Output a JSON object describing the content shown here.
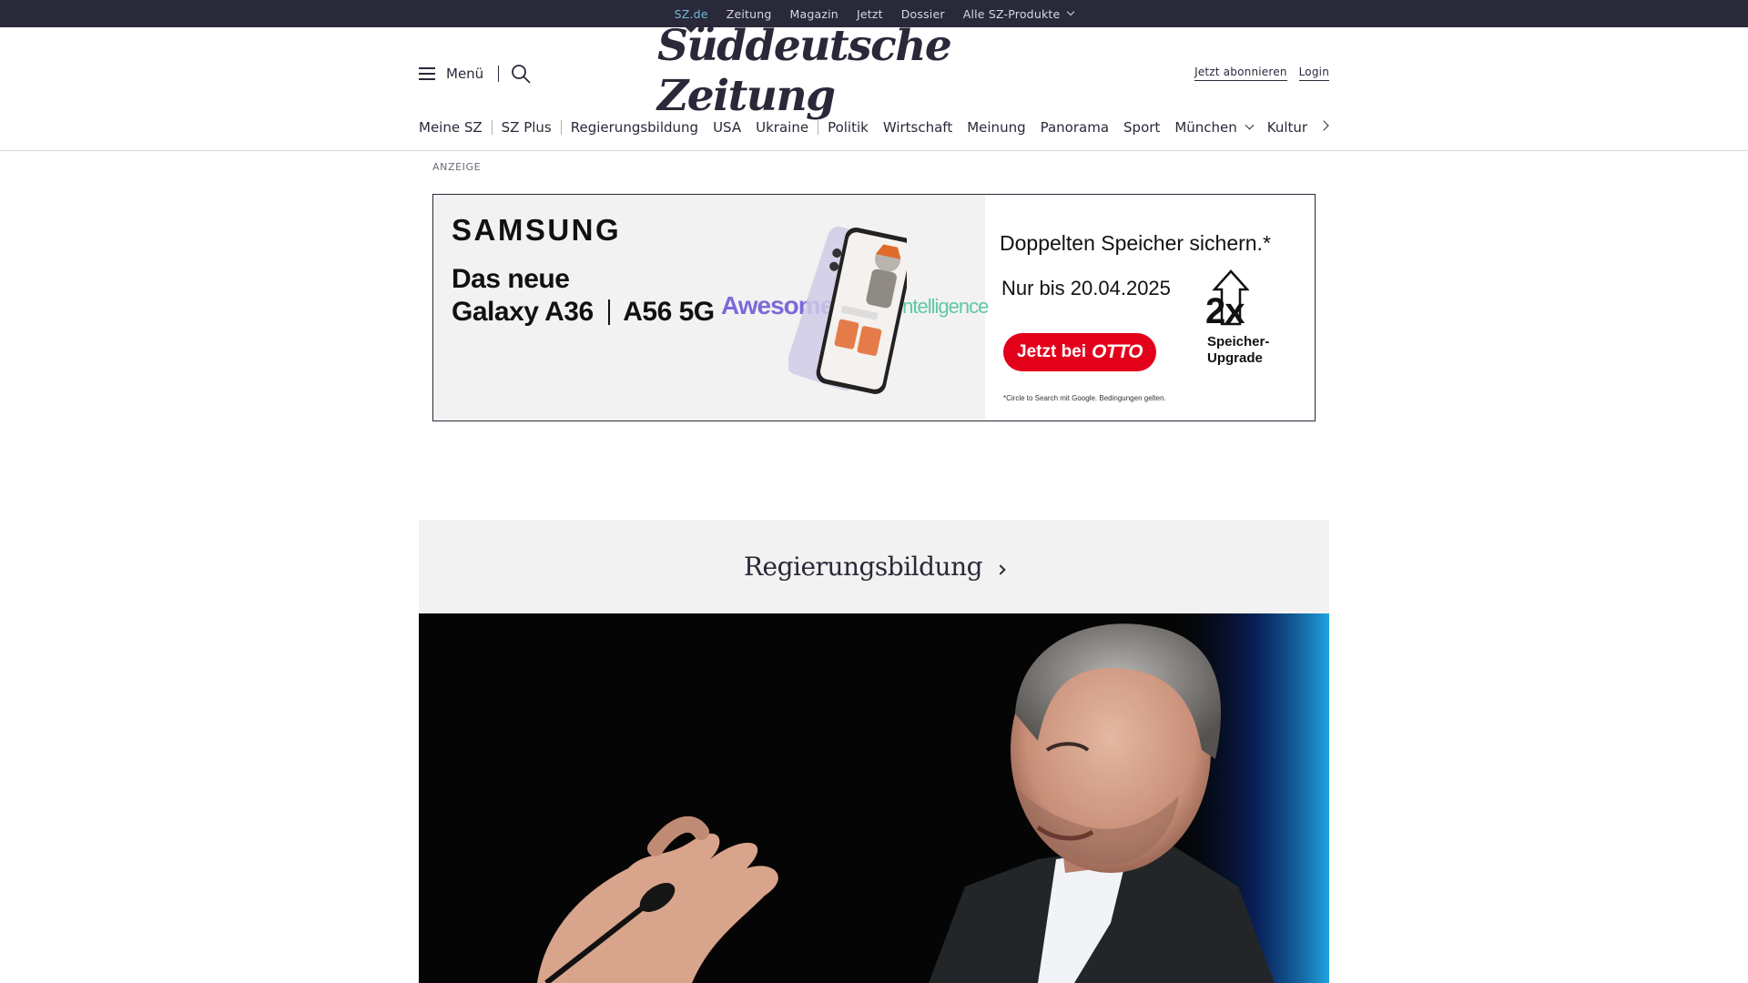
{
  "topbar": {
    "links": [
      {
        "label": "SZ.de",
        "active": true
      },
      {
        "label": "Zeitung"
      },
      {
        "label": "Magazin"
      },
      {
        "label": "Jetzt"
      },
      {
        "label": "Dossier"
      },
      {
        "label": "Alle SZ-Produkte",
        "dropdown": true
      }
    ]
  },
  "header": {
    "menu_label": "Menü",
    "logo_text": "Süddeutsche Zeitung",
    "subscribe_label": "Jetzt abonnieren",
    "login_label": "Login"
  },
  "nav": {
    "items": [
      "Meine SZ",
      "SZ Plus",
      "Regierungsbildung",
      "USA",
      "Ukraine",
      "Politik",
      "Wirtschaft",
      "Meinung",
      "Panorama",
      "Sport",
      "München",
      "Kultur"
    ]
  },
  "ad": {
    "label": "ANZEIGE",
    "brand": "SAMSUNG",
    "headline_1": "Das neue",
    "headline_2a": "Galaxy A36",
    "headline_2b": "A56 5G",
    "awesome": "Awesome",
    "intelligence": "Intelligence",
    "title": "Doppelten Speicher sichern.*",
    "date": "Nur bis 20.04.2025",
    "cta_prefix": "Jetzt bei",
    "cta_brand": "OTTO",
    "multiplier": "2x",
    "upgrade_1": "Speicher-",
    "upgrade_2": "Upgrade",
    "fineprint": "*Circle to Search mit Google. Bedingungen gelten."
  },
  "section": {
    "title": "Regierungsbildung"
  },
  "colors": {
    "topbar_bg": "#29293a",
    "active_link": "#71b8d3",
    "ad_cta": "#e3001b",
    "section_bg": "#f2f2f2"
  }
}
